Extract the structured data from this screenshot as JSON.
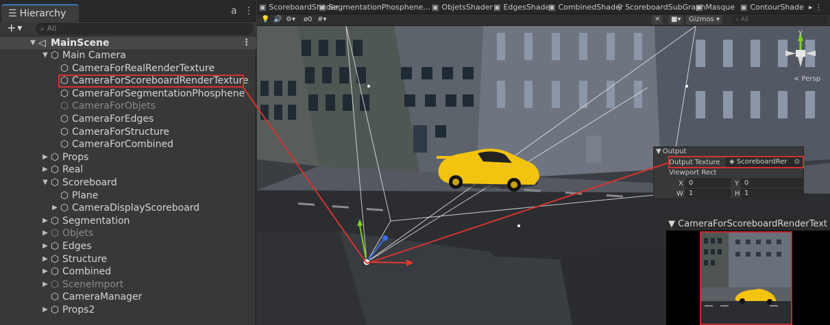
{
  "hierarchy": {
    "tab_title": "Hierarchy",
    "tab_icon": "list-icon",
    "lock_glyph": "a",
    "menu_glyph": "⋮",
    "add_label": "+",
    "search_placeholder": "All",
    "scene_name": "MainScene",
    "items": [
      {
        "label": "Main Camera",
        "indent": 1,
        "arrow": "down",
        "dim": false
      },
      {
        "label": "CameraForRealRenderTexture",
        "indent": 2,
        "arrow": "none",
        "dim": false
      },
      {
        "label": "CameraForScoreboardRenderTexture",
        "indent": 2,
        "arrow": "none",
        "dim": false
      },
      {
        "label": "CameraForSegmentationPhosphene",
        "indent": 2,
        "arrow": "none",
        "dim": false
      },
      {
        "label": "CameraForObjets",
        "indent": 2,
        "arrow": "none",
        "dim": true
      },
      {
        "label": "CameraForEdges",
        "indent": 2,
        "arrow": "none",
        "dim": false
      },
      {
        "label": "CameraForStructure",
        "indent": 2,
        "arrow": "none",
        "dim": false
      },
      {
        "label": "CameraForCombined",
        "indent": 2,
        "arrow": "none",
        "dim": false
      },
      {
        "label": "Props",
        "indent": 1,
        "arrow": "right",
        "dim": false
      },
      {
        "label": "Real",
        "indent": 1,
        "arrow": "right",
        "dim": false
      },
      {
        "label": "Scoreboard",
        "indent": 1,
        "arrow": "down",
        "dim": false
      },
      {
        "label": "Plane",
        "indent": 2,
        "arrow": "none",
        "dim": false
      },
      {
        "label": "CameraDisplayScoreboard",
        "indent": 2,
        "arrow": "right",
        "dim": false
      },
      {
        "label": "Segmentation",
        "indent": 1,
        "arrow": "right",
        "dim": false
      },
      {
        "label": "Objets",
        "indent": 1,
        "arrow": "right",
        "dim": true
      },
      {
        "label": "Edges",
        "indent": 1,
        "arrow": "right",
        "dim": false
      },
      {
        "label": "Structure",
        "indent": 1,
        "arrow": "right",
        "dim": false
      },
      {
        "label": "Combined",
        "indent": 1,
        "arrow": "right",
        "dim": false
      },
      {
        "label": "SceneImport",
        "indent": 1,
        "arrow": "right",
        "dim": true
      },
      {
        "label": "CameraManager",
        "indent": 1,
        "arrow": "none",
        "dim": false
      },
      {
        "label": "Props2",
        "indent": 1,
        "arrow": "right",
        "dim": false
      }
    ]
  },
  "scene": {
    "tabs": [
      {
        "label": "ScoreboardShader",
        "icon": "shader-icon"
      },
      {
        "label": "SegmentationPhosphene...",
        "icon": "shader-icon"
      },
      {
        "label": "ObjetsShader",
        "icon": "shader-icon"
      },
      {
        "label": "EdgesShader",
        "icon": "shader-icon"
      },
      {
        "label": "CombinedShader",
        "icon": "shader-icon"
      },
      {
        "label": "ScoreboardSubGraph",
        "icon": "subgraph-icon"
      },
      {
        "label": "Masque",
        "icon": "shader-icon"
      },
      {
        "label": "ContourShade",
        "icon": "shader-icon"
      }
    ],
    "tab_overflow": "▸ ⋮",
    "tools": {
      "hidden_count": "0",
      "gizmos_label": "Gizmos",
      "search_placeholder": "All"
    },
    "persp_label": "< Persp",
    "output": {
      "header": "Output",
      "output_texture_label": "Output Texture",
      "output_texture_value": "ScoreboardRer",
      "viewport_rect_label": "Viewport Rect",
      "x_label": "X",
      "x_value": "0",
      "y_label": "Y",
      "y_value": "0",
      "w_label": "W",
      "w_value": "1",
      "h_label": "H",
      "h_value": "1"
    },
    "preview_title": "CameraForScoreboardRenderText"
  },
  "colors": {
    "highlight_red": "#d83131",
    "accent_blue": "#3a79bb",
    "car_yellow": "#f2c30f"
  }
}
